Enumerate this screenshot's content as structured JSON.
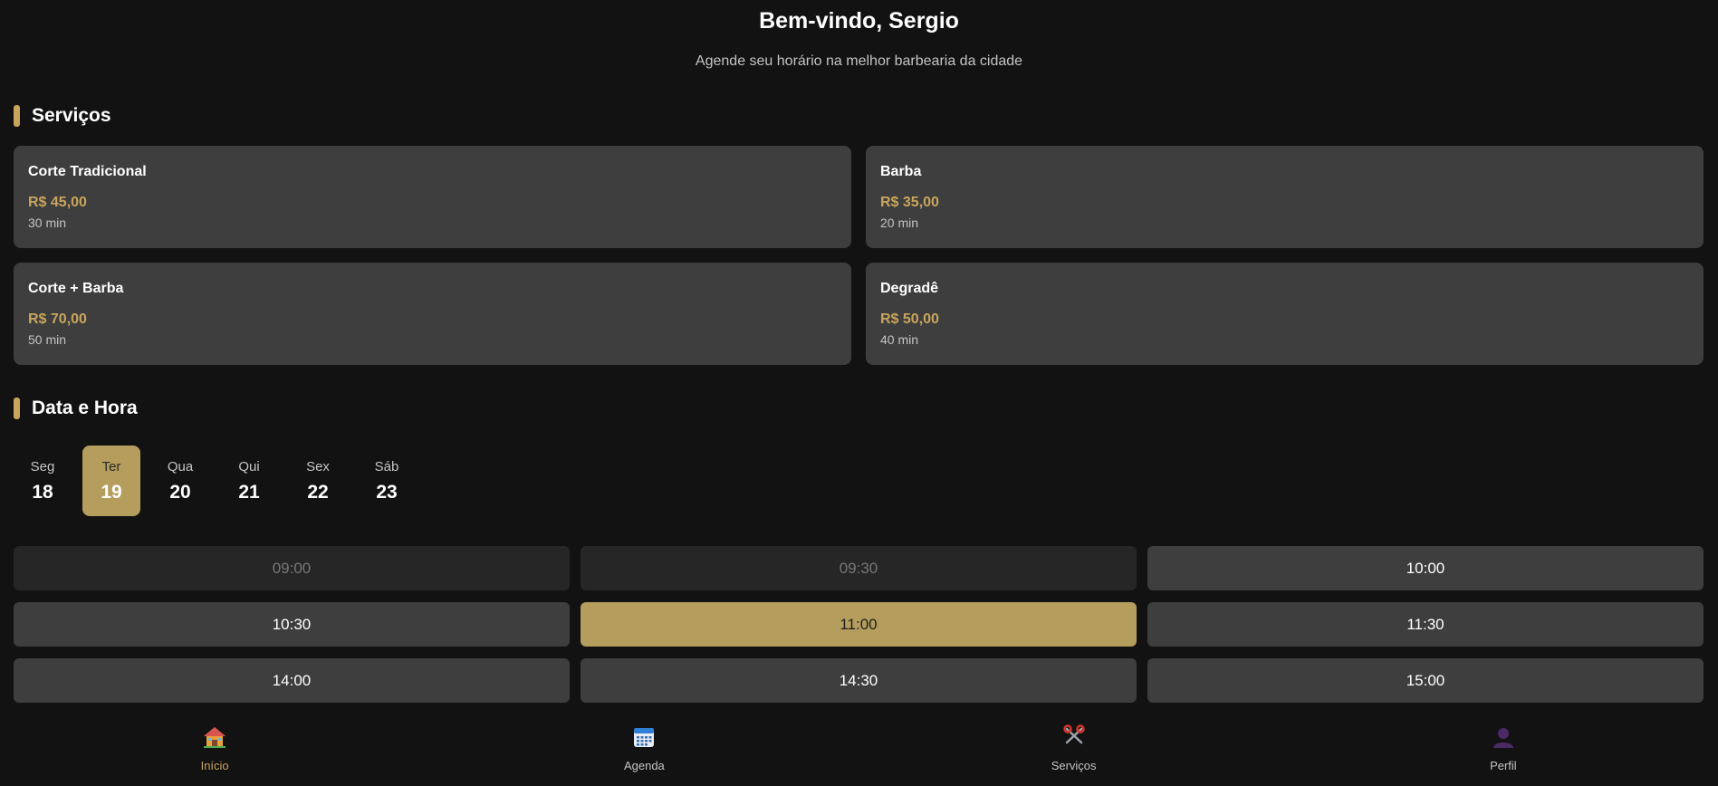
{
  "header": {
    "title": "Bem-vindo, Sergio",
    "subtitle": "Agende seu horário na melhor barbearia da cidade"
  },
  "sections": {
    "services_title": "Serviços",
    "datetime_title": "Data e Hora"
  },
  "services": [
    {
      "name": "Corte Tradicional",
      "price": "R$ 45,00",
      "duration": "30 min"
    },
    {
      "name": "Barba",
      "price": "R$ 35,00",
      "duration": "20 min"
    },
    {
      "name": "Corte + Barba",
      "price": "R$ 70,00",
      "duration": "50 min"
    },
    {
      "name": "Degradê",
      "price": "R$ 50,00",
      "duration": "40 min"
    }
  ],
  "days": [
    {
      "weekday": "Seg",
      "date": "18",
      "selected": false
    },
    {
      "weekday": "Ter",
      "date": "19",
      "selected": true
    },
    {
      "weekday": "Qua",
      "date": "20",
      "selected": false
    },
    {
      "weekday": "Qui",
      "date": "21",
      "selected": false
    },
    {
      "weekday": "Sex",
      "date": "22",
      "selected": false
    },
    {
      "weekday": "Sáb",
      "date": "23",
      "selected": false
    }
  ],
  "time_slots": [
    {
      "time": "09:00",
      "state": "disabled"
    },
    {
      "time": "09:30",
      "state": "disabled"
    },
    {
      "time": "10:00",
      "state": "available"
    },
    {
      "time": "10:30",
      "state": "available"
    },
    {
      "time": "11:00",
      "state": "selected"
    },
    {
      "time": "11:30",
      "state": "available"
    },
    {
      "time": "14:00",
      "state": "available"
    },
    {
      "time": "14:30",
      "state": "available"
    },
    {
      "time": "15:00",
      "state": "available"
    }
  ],
  "bottom_nav": [
    {
      "label": "Início",
      "icon": "home-icon",
      "active": true
    },
    {
      "label": "Agenda",
      "icon": "calendar-icon",
      "active": false
    },
    {
      "label": "Serviços",
      "icon": "scissors-icon",
      "active": false
    },
    {
      "label": "Perfil",
      "icon": "user-icon",
      "active": false
    }
  ],
  "colors": {
    "background": "#121212",
    "card": "#3e3e3e",
    "accent": "#c9a55c",
    "selected": "#b59d5e"
  }
}
